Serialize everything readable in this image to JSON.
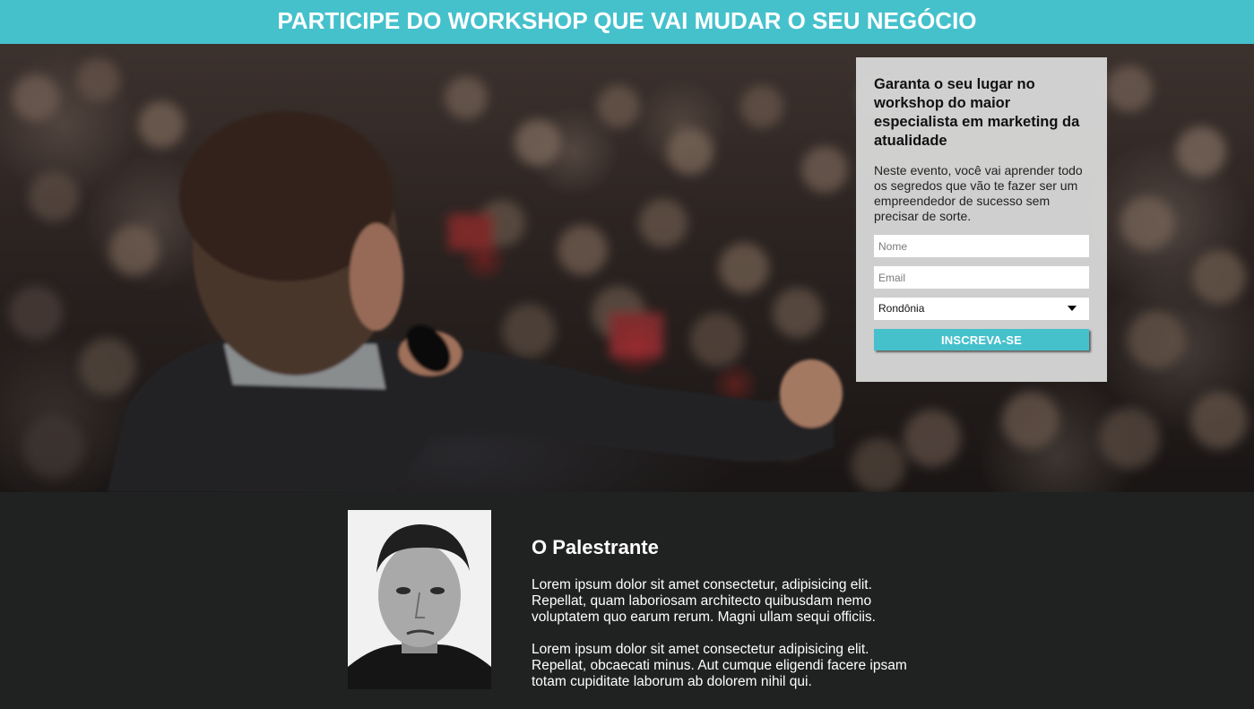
{
  "banner": {
    "title": "PARTICIPE DO WORKSHOP QUE VAI MUDAR O SEU NEGÓCIO",
    "background_color": "#45c1cc"
  },
  "hero": {
    "image": "speaker-on-stage-with-audience-photo"
  },
  "signup": {
    "heading": "Garanta o seu lugar no workshop do maior especialista em marketing da atualidade",
    "description": "Neste evento, você vai aprender todo os segredos que vão te fazer ser um empreendedor de sucesso sem precisar de sorte.",
    "name_placeholder": "Nome",
    "email_placeholder": "Email",
    "state_selected": "Rondônia",
    "submit_label": "INSCREVA-SE",
    "accent_color": "#45c1cc"
  },
  "speaker": {
    "photo": "speaker-portrait-bw-photo",
    "title": "O Palestrante",
    "paragraphs": [
      "Lorem ipsum dolor sit amet consectetur, adipisicing elit. Repellat, quam laboriosam architecto quibusdam nemo voluptatem quo earum rerum. Magni ullam sequi officiis.",
      "Lorem ipsum dolor sit amet consectetur adipisicing elit. Repellat, obcaecati minus. Aut cumque eligendi facere ipsam totam cupiditate laborum ab dolorem nihil qui."
    ]
  }
}
